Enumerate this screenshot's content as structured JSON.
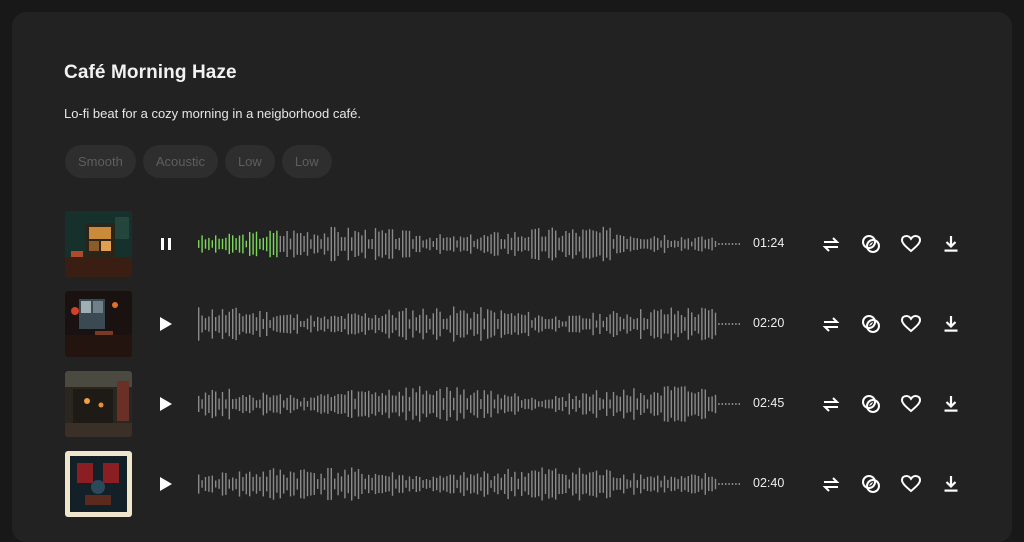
{
  "playlist": {
    "title": "Café Morning Haze",
    "description": "Lo-fi beat for a cozy morning in a neigborhood café.",
    "tags": [
      "Smooth",
      "Acoustic",
      "Low",
      "Low"
    ]
  },
  "colors": {
    "played": "#7bd95a",
    "unplayed": "#8a8a8a",
    "tag_text": "#5e5e5e"
  },
  "tracks": [
    {
      "duration": "01:24",
      "state": "playing",
      "progress": 0.15,
      "play_icon": "pause-icon",
      "seed": 3,
      "thumb": "green-cafe"
    },
    {
      "duration": "02:20",
      "state": "paused",
      "progress": 0,
      "play_icon": "play-icon",
      "seed": 11,
      "thumb": "window-cafe"
    },
    {
      "duration": "02:45",
      "state": "paused",
      "progress": 0,
      "play_icon": "play-icon",
      "seed": 27,
      "thumb": "street-cafe"
    },
    {
      "duration": "02:40",
      "state": "paused",
      "progress": 0,
      "play_icon": "play-icon",
      "seed": 41,
      "thumb": "poster-cafe"
    }
  ],
  "actions": [
    "repeat-icon",
    "remix-icon",
    "heart-icon",
    "download-icon"
  ]
}
